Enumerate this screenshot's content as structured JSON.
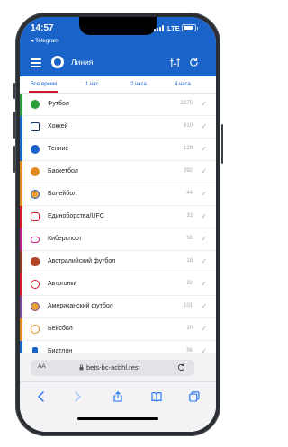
{
  "status_bar": {
    "time": "14:57",
    "back_app": "◂ Telegram",
    "network": "LTE"
  },
  "header": {
    "title": "Линия"
  },
  "tabs": [
    {
      "label": "Все время",
      "active": true
    },
    {
      "label": "1 час",
      "active": false
    },
    {
      "label": "2 часа",
      "active": false
    },
    {
      "label": "4 часа",
      "active": false
    }
  ],
  "sports": [
    {
      "name": "Футбол",
      "count": "2275",
      "color": "#2a9d3a",
      "icon": "soccer-ball-icon"
    },
    {
      "name": "Хоккей",
      "count": "810",
      "color": "#1a63c8",
      "icon": "hockey-sticks-icon"
    },
    {
      "name": "Теннис",
      "count": "129",
      "color": "#1a63c8",
      "icon": "tennis-ball-icon"
    },
    {
      "name": "Баскетбол",
      "count": "392",
      "color": "#e08a1e",
      "icon": "basketball-icon"
    },
    {
      "name": "Волейбол",
      "count": "44",
      "color": "#e08a1e",
      "icon": "volleyball-icon"
    },
    {
      "name": "Единоборства/UFC",
      "count": "31",
      "color": "#d11b2a",
      "icon": "boxing-glove-icon"
    },
    {
      "name": "Киберспорт",
      "count": "68",
      "color": "#c0208a",
      "icon": "gamepad-icon"
    },
    {
      "name": "Австралийский футбол",
      "count": "18",
      "color": "#8a3d1e",
      "icon": "aussie-football-icon"
    },
    {
      "name": "Автогонки",
      "count": "22",
      "color": "#d11b2a",
      "icon": "race-car-icon"
    },
    {
      "name": "Американский футбол",
      "count": "101",
      "color": "#7a4a9a",
      "icon": "helmet-icon"
    },
    {
      "name": "Бейсбол",
      "count": "20",
      "color": "#e08a1e",
      "icon": "baseball-icon"
    },
    {
      "name": "Биатлон",
      "count": "86",
      "color": "#1a63c8",
      "icon": "biathlon-icon"
    }
  ],
  "browser": {
    "text_size": "AA",
    "url": "bets-bc-acbhl.rest"
  },
  "colors": {
    "brand_blue": "#1a63c8",
    "active_tab_underline": "#d11b2a"
  }
}
